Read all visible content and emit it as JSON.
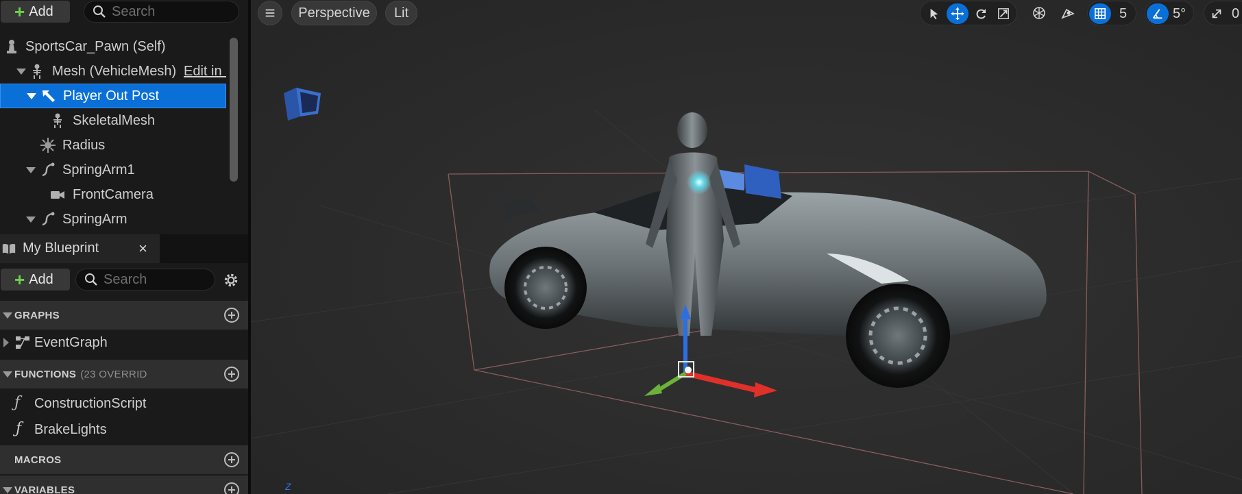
{
  "components": {
    "add_label": "Add",
    "search_placeholder": "Search",
    "tree": [
      {
        "label": "SportsCar_Pawn (Self)",
        "icon": "pawn-icon"
      },
      {
        "label": "Mesh (VehicleMesh)",
        "icon": "skeleton-icon",
        "link": "Edit in C"
      },
      {
        "label": "Player Out Post",
        "icon": "arrow-component-icon",
        "selected": true
      },
      {
        "label": "SkeletalMesh",
        "icon": "skeleton-icon"
      },
      {
        "label": "Radius",
        "icon": "radius-icon"
      },
      {
        "label": "SpringArm1",
        "icon": "spring-arm-icon"
      },
      {
        "label": "FrontCamera",
        "icon": "camera-icon"
      },
      {
        "label": "SpringArm",
        "icon": "spring-arm-icon"
      }
    ]
  },
  "my_blueprint": {
    "tab_label": "My Blueprint",
    "close_label": "×",
    "add_label": "Add",
    "search_placeholder": "Search",
    "sections": {
      "graphs": {
        "label": "GRAPHS",
        "items": [
          "EventGraph"
        ]
      },
      "functions": {
        "label": "FUNCTIONS",
        "count": "(23 OVERRID",
        "items": [
          "ConstructionScript",
          "BrakeLights"
        ]
      },
      "macros": {
        "label": "MACROS"
      },
      "variables": {
        "label": "VARIABLES"
      }
    }
  },
  "viewport": {
    "view_mode": "Perspective",
    "lighting_mode": "Lit",
    "grid_snap": "5",
    "rotation_snap": "5°",
    "scale_snap": "0",
    "axis_label": "Z",
    "accent_color": "#0a70d8"
  }
}
